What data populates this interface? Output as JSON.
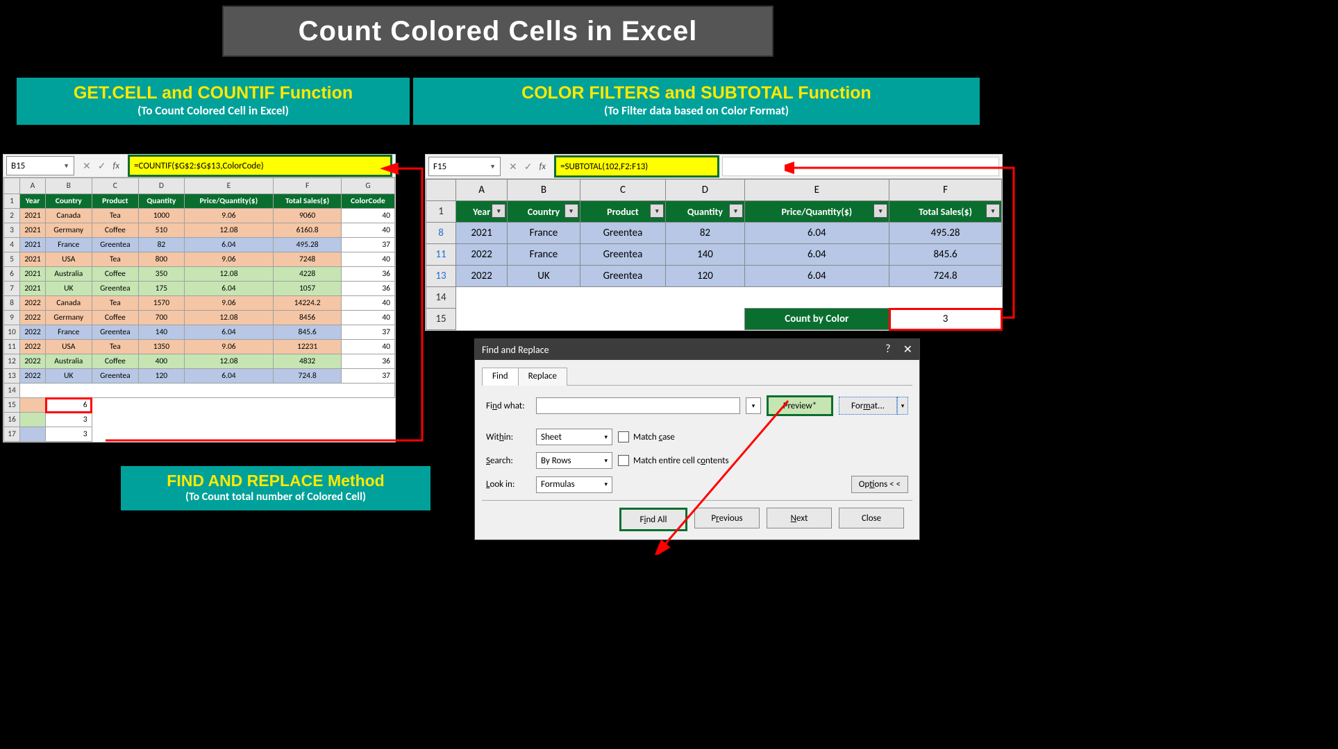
{
  "title": "Count Colored Cells in Excel",
  "box1": {
    "h": "GET.CELL and COUNTIF Function",
    "s": "(To Count Colored Cell in Excel)"
  },
  "box2": {
    "h": "COLOR FILTERS and SUBTOTAL Function",
    "s": "(To Filter data based on Color Format)"
  },
  "box3": {
    "h": "FIND AND REPLACE Method",
    "s": "(To Count total number of Colored Cell)"
  },
  "sheet1": {
    "cellref": "B15",
    "formula": "=COUNTIF($G$2:$G$13,ColorCode)",
    "cols": [
      "A",
      "B",
      "C",
      "D",
      "E",
      "F",
      "G"
    ],
    "headers": [
      "Year",
      "Country",
      "Product",
      "Quantity",
      "Price/Quantity($)",
      "Total Sales($)",
      "ColorCode"
    ],
    "rows": [
      {
        "n": "2",
        "color": "peach",
        "c": [
          "2021",
          "Canada",
          "Tea",
          "1000",
          "9.06",
          "9060",
          "40"
        ]
      },
      {
        "n": "3",
        "color": "peach",
        "c": [
          "2021",
          "Germany",
          "Coffee",
          "510",
          "12.08",
          "6160.8",
          "40"
        ]
      },
      {
        "n": "4",
        "color": "lilac",
        "c": [
          "2021",
          "France",
          "Greentea",
          "82",
          "6.04",
          "495.28",
          "37"
        ]
      },
      {
        "n": "5",
        "color": "peach",
        "c": [
          "2021",
          "USA",
          "Tea",
          "800",
          "9.06",
          "7248",
          "40"
        ]
      },
      {
        "n": "6",
        "color": "mint",
        "c": [
          "2021",
          "Australia",
          "Coffee",
          "350",
          "12.08",
          "4228",
          "36"
        ]
      },
      {
        "n": "7",
        "color": "mint",
        "c": [
          "2021",
          "UK",
          "Greentea",
          "175",
          "6.04",
          "1057",
          "36"
        ]
      },
      {
        "n": "8",
        "color": "peach",
        "c": [
          "2022",
          "Canada",
          "Tea",
          "1570",
          "9.06",
          "14224.2",
          "40"
        ]
      },
      {
        "n": "9",
        "color": "peach",
        "c": [
          "2022",
          "Germany",
          "Coffee",
          "700",
          "12.08",
          "8456",
          "40"
        ]
      },
      {
        "n": "10",
        "color": "lilac",
        "c": [
          "2022",
          "France",
          "Greentea",
          "140",
          "6.04",
          "845.6",
          "37"
        ]
      },
      {
        "n": "11",
        "color": "peach",
        "c": [
          "2022",
          "USA",
          "Tea",
          "1350",
          "9.06",
          "12231",
          "40"
        ]
      },
      {
        "n": "12",
        "color": "mint",
        "c": [
          "2022",
          "Australia",
          "Coffee",
          "400",
          "12.08",
          "4832",
          "36"
        ]
      },
      {
        "n": "13",
        "color": "lilac",
        "c": [
          "2022",
          "UK",
          "Greentea",
          "120",
          "6.04",
          "724.8",
          "37"
        ]
      }
    ],
    "r14": "14",
    "r15": {
      "n": "15",
      "a_color": "peach",
      "b": "6"
    },
    "r16": {
      "n": "16",
      "a_color": "mint",
      "b": "3"
    },
    "r17": {
      "n": "17",
      "a_color": "lilac",
      "b": "3"
    }
  },
  "sheet2": {
    "cellref": "F15",
    "formula": "=SUBTOTAL(102,F2:F13)",
    "cols": [
      "A",
      "B",
      "C",
      "D",
      "E",
      "F"
    ],
    "headers": [
      "Year",
      "Country",
      "Product",
      "Quantity",
      "Price/Quantity($)",
      "Total Sales($)"
    ],
    "rows": [
      {
        "n": "8",
        "c": [
          "2021",
          "France",
          "Greentea",
          "82",
          "6.04",
          "495.28"
        ]
      },
      {
        "n": "11",
        "c": [
          "2022",
          "France",
          "Greentea",
          "140",
          "6.04",
          "845.6"
        ]
      },
      {
        "n": "13",
        "c": [
          "2022",
          "UK",
          "Greentea",
          "120",
          "6.04",
          "724.8"
        ]
      }
    ],
    "r14": "14",
    "r15": "15",
    "count_label": "Count by Color",
    "count_value": "3"
  },
  "fr": {
    "title": "Find and Replace",
    "tab_find": "Find",
    "tab_replace": "Replace",
    "find_what": "Find what:",
    "preview": "Preview*",
    "format": "Format...",
    "within": "Within:",
    "within_v": "Sheet",
    "search": "Search:",
    "search_v": "By Rows",
    "lookin": "Look in:",
    "lookin_v": "Formulas",
    "match_case": "Match case",
    "match_contents": "Match entire cell contents",
    "options": "Options < <",
    "findall": "Find All",
    "previous": "Previous",
    "next": "Next",
    "close": "Close"
  }
}
